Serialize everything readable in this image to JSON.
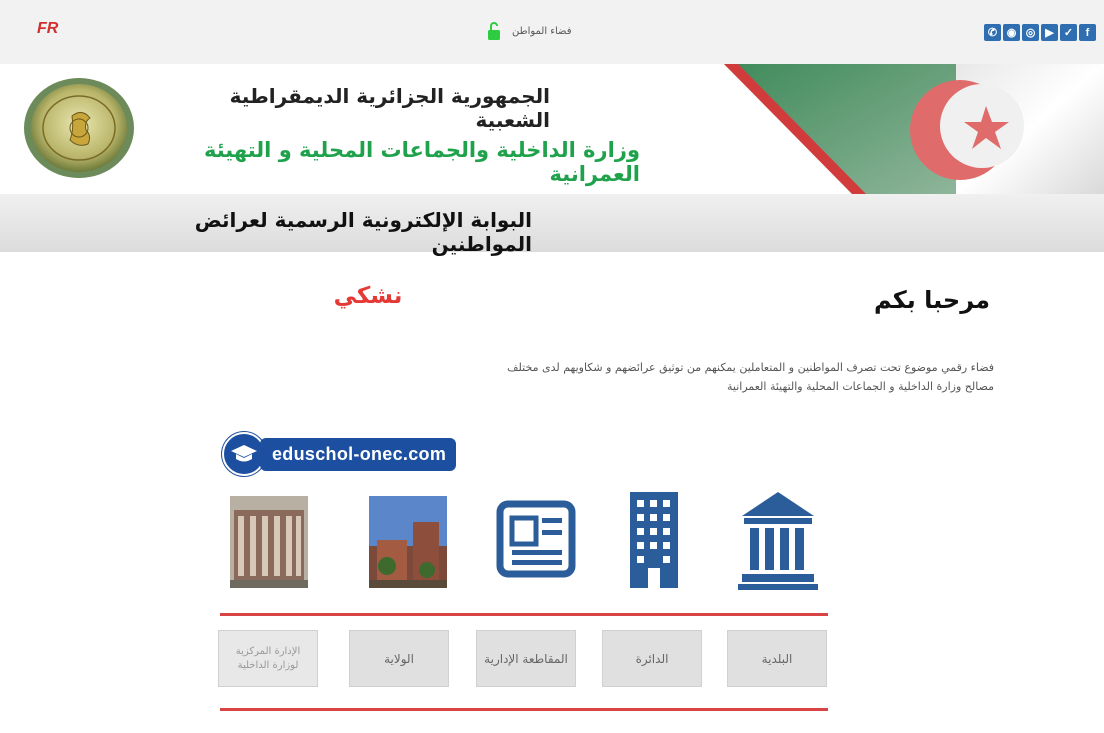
{
  "topbar": {
    "lang_switch": "FR",
    "citizen_space": "فضاء المواطن",
    "social_icons": [
      "whatsapp-icon",
      "rss-icon",
      "instagram-icon",
      "youtube-icon",
      "twitter-icon",
      "facebook-icon"
    ]
  },
  "header": {
    "republic": "الجمهورية الجزائرية الديمقراطية الشعبية",
    "ministry": "وزارة الداخلية والجماعات المحلية و التهيئة العمرانية"
  },
  "portal": {
    "title": "البوابة الإلكترونية الرسمية  لعرائض المواطنين"
  },
  "main": {
    "complain_link": "نشكي",
    "welcome": "مرحبا بكم",
    "description_line1": "فضاء رقمي موضوع تحت تصرف المواطنين و المتعاملين يمكنهم من توثيق عرائضهم و شكاويهم لدى مختلف",
    "description_line2": "مصالح وزارة الداخلية و الجماعات المحلية والتهيئة العمرانية"
  },
  "watermark": {
    "text": "eduschol-onec.com"
  },
  "categories": [
    {
      "label": "البلدية",
      "icon": "bank-building-icon"
    },
    {
      "label": "الدائرة",
      "icon": "office-building-icon"
    },
    {
      "label": "المقاطعة الإدارية",
      "icon": "newspaper-icon"
    },
    {
      "label": "الولاية",
      "icon": "wilaya-photo"
    },
    {
      "label": "الإدارة المركزية لوزارة الداخلية",
      "icon": "ministry-photo"
    }
  ],
  "colors": {
    "accent_red": "#d84343",
    "brand_green": "#1fa24b",
    "icon_blue": "#2b5d9a"
  }
}
